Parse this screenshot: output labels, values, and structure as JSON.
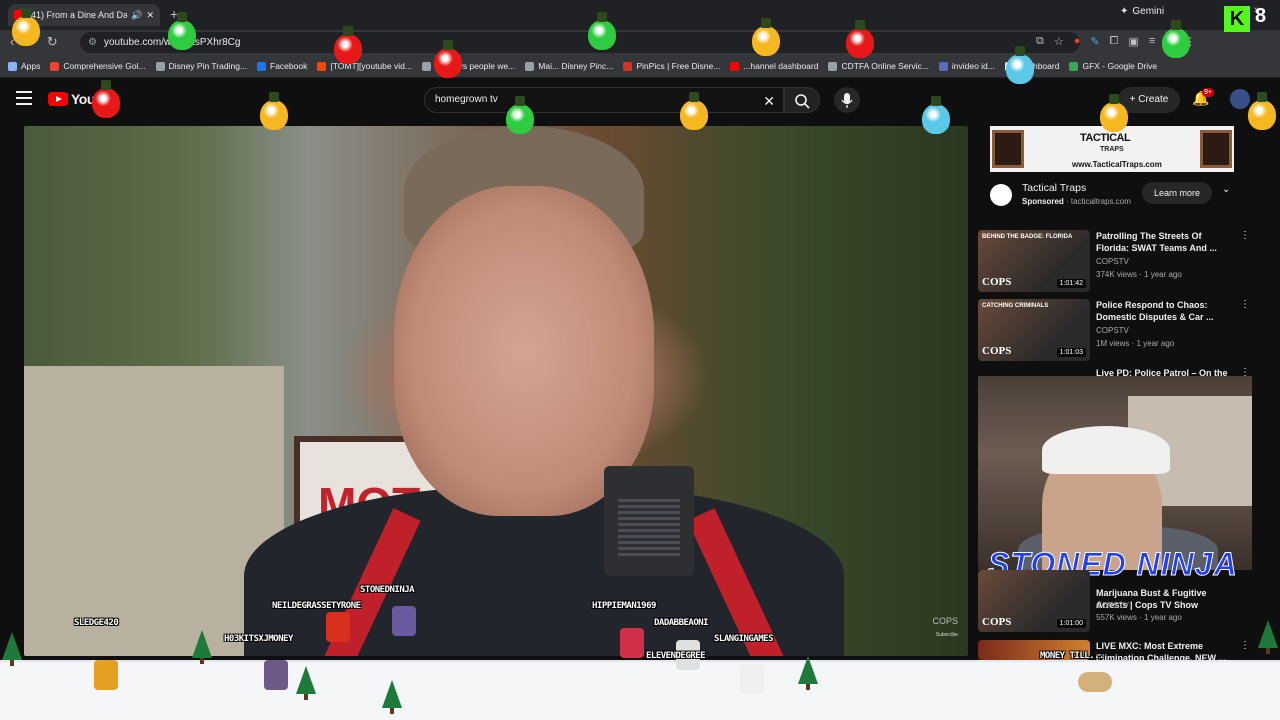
{
  "browser": {
    "tab_title": "(41) From a Dine And Dash",
    "new_tab": "+",
    "gemini_label": "Gemini",
    "url": "youtube.com/w=HbksPXhr8Cg",
    "bookmarks": [
      {
        "label": "Apps",
        "color": "#8ab4f8"
      },
      {
        "label": "Comprehensive Gol...",
        "color": "#ea4335"
      },
      {
        "label": "Disney Pin Trading...",
        "color": "#9aa0a6"
      },
      {
        "label": "Facebook",
        "color": "#1877f2"
      },
      {
        "label": "[TOMT][youtube vid...",
        "color": "#ff4500"
      },
      {
        "label": "If todays people we...",
        "color": "#9aa0a6"
      },
      {
        "label": "Mai... Disney Pinc...",
        "color": "#9aa0a6"
      },
      {
        "label": "PinPics | Free Disne...",
        "color": "#d93025"
      },
      {
        "label": "...hannel dashboard",
        "color": "#ff0000"
      },
      {
        "label": "CDTFA Online Servic...",
        "color": "#9aa0a6"
      },
      {
        "label": "invideo id...",
        "color": "#5c6bc0"
      },
      {
        "label": "Dashboard",
        "color": "#e8eaed"
      },
      {
        "label": "GFX - Google Drive",
        "color": "#34a853"
      }
    ],
    "more_bookmarks": "»"
  },
  "youtube": {
    "logo_text": "YouT",
    "search_value": "homegrown tv",
    "create_label": "Create",
    "notif_count": "9+",
    "colors": {
      "brand_red": "#ff0000",
      "bg": "#0f0f0f"
    }
  },
  "video": {
    "sign_text": "MOT",
    "watermark": "COPS",
    "subscribe": "Subscribe"
  },
  "ad": {
    "banner_brand": "TACTICAL",
    "banner_sub": "TRAPS",
    "banner_url": "www.TacticalTraps.com",
    "name": "Tactical Traps",
    "sponsored": "Sponsored",
    "domain": "tacticaltraps.com",
    "cta": "Learn more"
  },
  "recommendations": [
    {
      "title": "Patrolling The Streets Of Florida: SWAT Teams And ...",
      "channel": "COPSTV",
      "meta": "374K views · 1 year ago",
      "duration": "1:01:42",
      "tag": "BEHIND THE BADGE: FLORIDA"
    },
    {
      "title": "Police Respond to Chaos: Domestic Disputes & Car ...",
      "channel": "COPSTV",
      "meta": "1M views · 1 year ago",
      "duration": "1:01:03",
      "tag": "CATCHING CRIMINALS"
    },
    {
      "title": "Live PD: Police Patrol – On the",
      "channel": "",
      "meta": "",
      "duration": "",
      "tag": ""
    },
    {
      "title": "Marijuana Bust & Fugitive Arrests | Cops TV Show",
      "channel": "COPSTV",
      "meta": "557K views · 1 year ago",
      "duration": "1:01:00",
      "tag": ""
    },
    {
      "title": "LIVE MXC: Most Extreme Elimination Challenge. NEW ...",
      "channel": "",
      "meta": "",
      "duration": "",
      "tag": ""
    }
  ],
  "overlay": {
    "stoned_ninja": "STONED NINJA",
    "kick_letter": "K",
    "kick_count": "8",
    "chat_names": [
      "SLEDGE420",
      "NEILDEGRASSETYRONE",
      "STONEDNINJA",
      "H03KITSXJMONEY",
      "HIPPIEMAN1969",
      "DADABBEAONI",
      "SLANGINGAMES",
      "ELEVENDEGREE",
      "MONEY TILL..."
    ]
  }
}
